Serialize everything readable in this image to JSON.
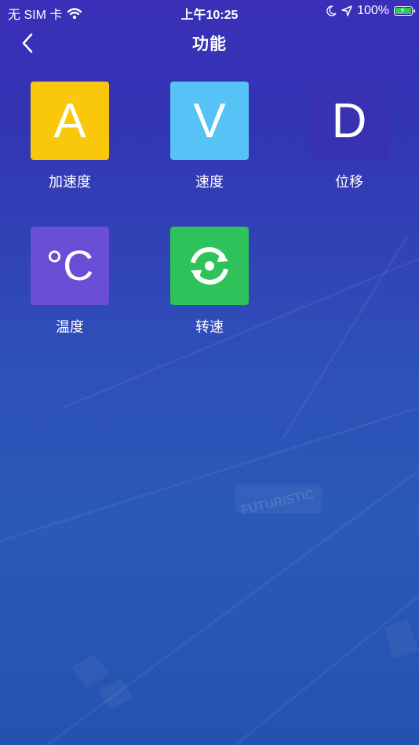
{
  "status_bar": {
    "carrier": "无 SIM 卡",
    "time": "上午10:25",
    "battery_percent": "100%",
    "battery_level": 1.0,
    "icons": [
      "wifi-icon",
      "moon-icon",
      "location-arrow-icon",
      "battery-charging-icon"
    ]
  },
  "nav": {
    "title": "功能",
    "back_icon": "chevron-left-icon"
  },
  "functions": [
    {
      "letter": "A",
      "label": "加速度",
      "color": "#f9c80a"
    },
    {
      "letter": "V",
      "label": "速度",
      "color": "#56c2f5"
    },
    {
      "letter": "D",
      "label": "位移",
      "color": "#3831b0"
    },
    {
      "letter": "°C",
      "label": "温度",
      "color": "#6a4fd6"
    },
    {
      "letter": "",
      "label": "转速",
      "color": "#2ec35a",
      "icon": "rotation-icon"
    }
  ],
  "background": {
    "watermark_text": "FUTURISTIC"
  }
}
